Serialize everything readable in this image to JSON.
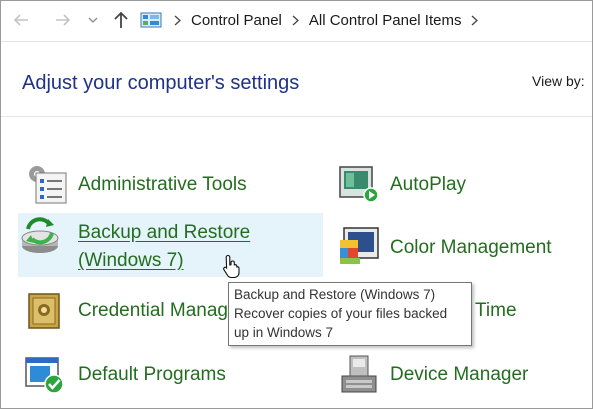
{
  "breadcrumb": {
    "items": [
      "Control Panel",
      "All Control Panel Items"
    ]
  },
  "header": {
    "title": "Adjust your computer's settings",
    "view_by_label": "View by:"
  },
  "items": [
    {
      "label": "Administrative Tools",
      "icon": "administrative-tools-icon"
    },
    {
      "label": "AutoPlay",
      "icon": "autoplay-icon"
    },
    {
      "label_line1": "Backup and Restore",
      "label_line2": "(Windows 7)",
      "icon": "backup-restore-icon"
    },
    {
      "label": "Color Management",
      "icon": "color-management-icon"
    },
    {
      "label": "Credential Manag",
      "icon": "credential-manager-icon"
    },
    {
      "label": "Time",
      "icon": "date-time-icon"
    },
    {
      "label": "Default Programs",
      "icon": "default-programs-icon"
    },
    {
      "label": "Device Manager",
      "icon": "device-manager-icon"
    }
  ],
  "tooltip": {
    "line1": "Backup and Restore (Windows 7)",
    "line2": "Recover copies of your files backed",
    "line3": "up in Windows 7"
  },
  "colors": {
    "title": "#1e3287",
    "item_text": "#236d1f",
    "hover_background": "#e5f3fb"
  }
}
